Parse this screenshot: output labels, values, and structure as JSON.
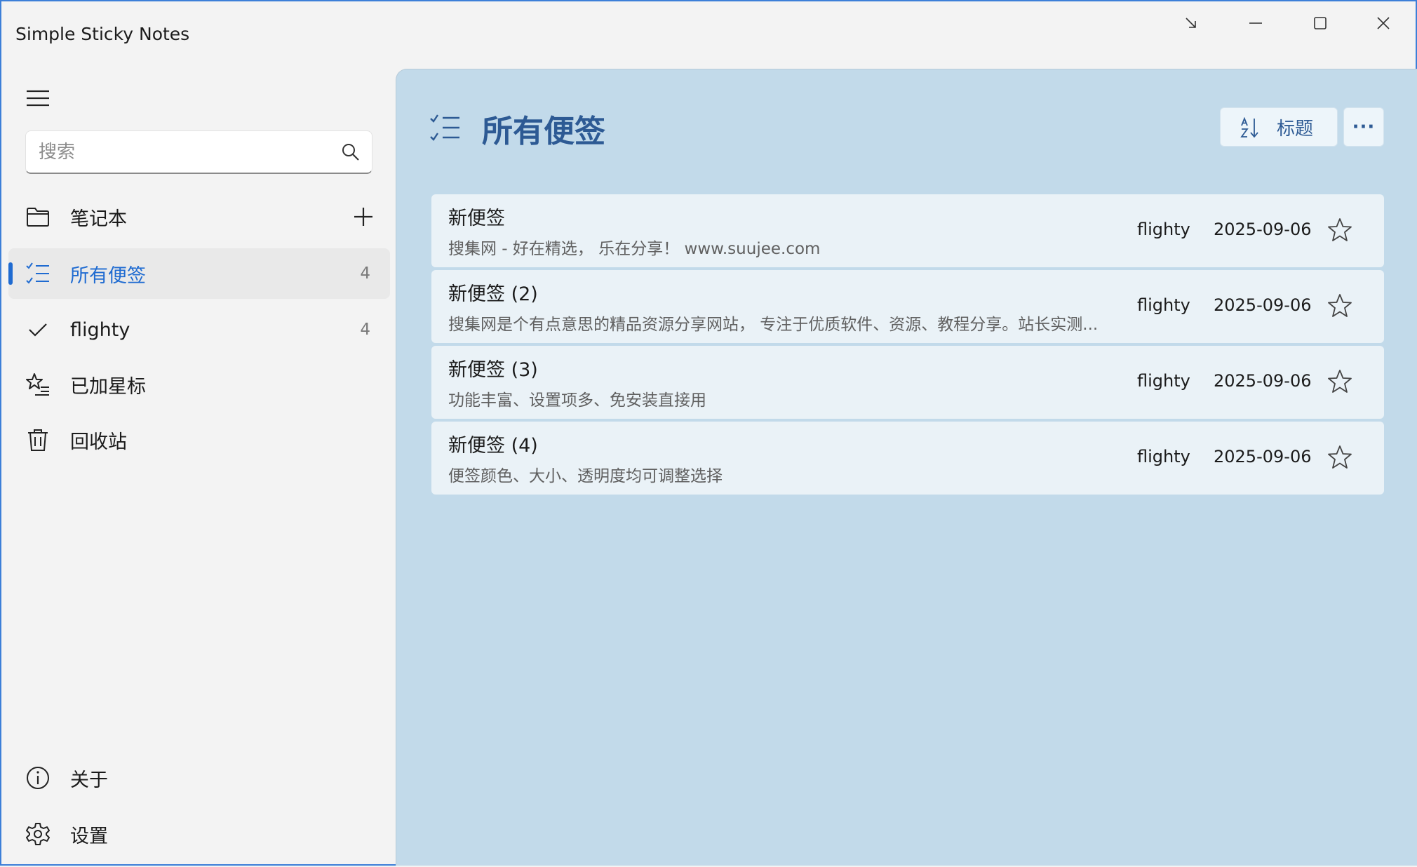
{
  "app": {
    "title": "Simple Sticky Notes"
  },
  "search": {
    "placeholder": "搜索",
    "value": ""
  },
  "sidebar": {
    "items": [
      {
        "label": "笔记本",
        "icon": "folder-icon",
        "count": ""
      },
      {
        "label": "所有便签",
        "icon": "checklist-icon",
        "count": "4",
        "selected": true
      },
      {
        "label": "flighty",
        "icon": "check-icon",
        "count": "4"
      },
      {
        "label": "已加星标",
        "icon": "star-list-icon",
        "count": ""
      },
      {
        "label": "回收站",
        "icon": "trash-icon",
        "count": ""
      }
    ],
    "footer": [
      {
        "label": "关于",
        "icon": "info-icon"
      },
      {
        "label": "设置",
        "icon": "gear-icon"
      }
    ]
  },
  "main": {
    "title": "所有便签",
    "sort_label": "标题",
    "more_label": "···",
    "notes": [
      {
        "title": "新便签",
        "preview": "搜集网 - 好在精选， 乐在分享！ www.suujee.com",
        "notebook": "flighty",
        "date": "2025-09-06",
        "starred": false
      },
      {
        "title": "新便签 (2)",
        "preview": "搜集网是个有点意思的精品资源分享网站， 专注于优质软件、资源、教程分享。站长实测...",
        "notebook": "flighty",
        "date": "2025-09-06",
        "starred": false
      },
      {
        "title": "新便签 (3)",
        "preview": "功能丰富、设置项多、免安装直接用",
        "notebook": "flighty",
        "date": "2025-09-06",
        "starred": false
      },
      {
        "title": "新便签 (4)",
        "preview": "便签颜色、大小、透明度均可调整选择",
        "notebook": "flighty",
        "date": "2025-09-06",
        "starred": false
      }
    ]
  },
  "colors": {
    "accent": "#1f6bd1",
    "main_bg": "#c2daea",
    "title_color": "#2d5a94"
  }
}
